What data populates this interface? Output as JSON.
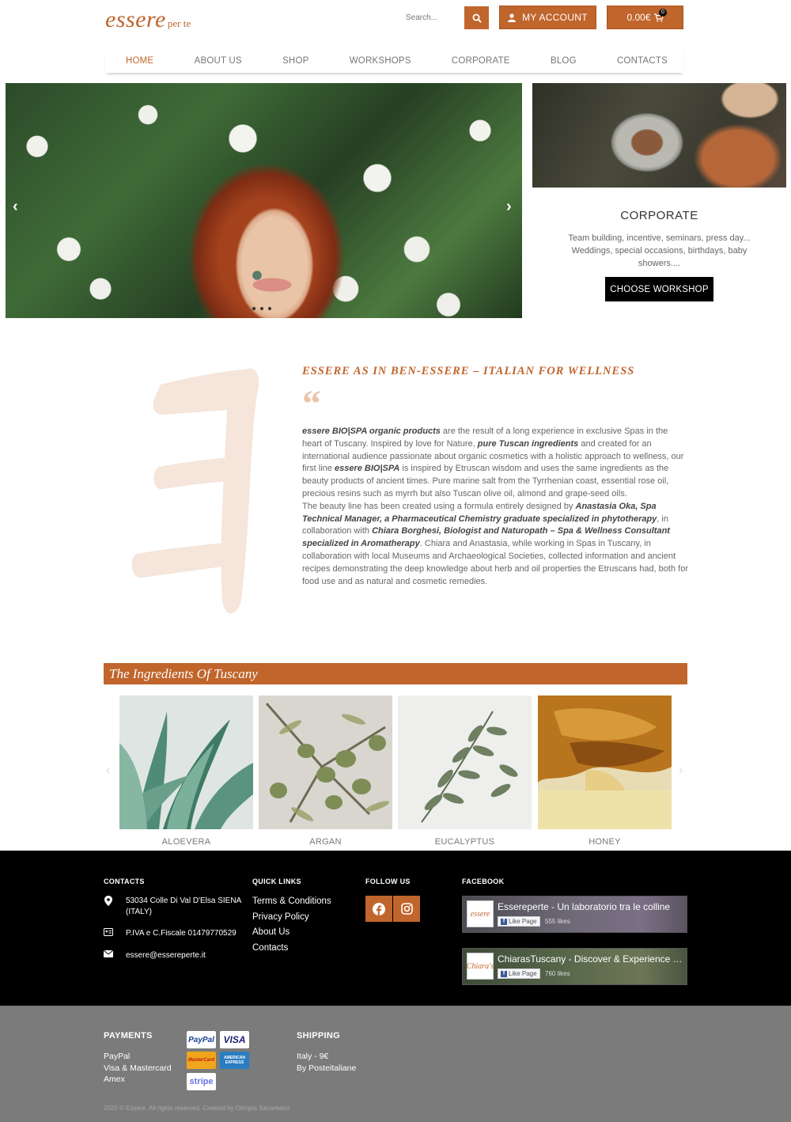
{
  "header": {
    "logo_main": "essere",
    "logo_sub": "per te",
    "search_placeholder": "Search...",
    "account_label": "MY ACCOUNT",
    "cart_total": "0.00€",
    "cart_count": "0"
  },
  "nav": {
    "items": [
      {
        "label": "HOME",
        "active": true
      },
      {
        "label": "ABOUT US"
      },
      {
        "label": "SHOP"
      },
      {
        "label": "WORKSHOPS"
      },
      {
        "label": "CORPORATE"
      },
      {
        "label": "BLOG"
      },
      {
        "label": "CONTACTS"
      }
    ]
  },
  "hero": {
    "prev_icon": "chevron-left-icon",
    "next_icon": "chevron-right-icon",
    "slide_count": 3
  },
  "corporate": {
    "title": "CORPORATE",
    "text": "Team building, incentive, seminars, press day... Weddings, special occasions, birthdays, baby showers....",
    "button_label": "CHOOSE WORKSHOP"
  },
  "about": {
    "title": "ESSERE AS IN BEN-ESSERE – ITALIAN FOR WELLNESS",
    "quote_mark": "“",
    "p1_b1": "essere BIO|SPA organic products",
    "p1_t1": " are the result of a long experience in exclusive Spas in the heart of Tuscany. Inspired by love for Nature, ",
    "p1_b2": "pure Tuscan ingredients",
    "p1_t2": " and created for an international audience passionate about organic cosmetics with a holistic approach to wellness, our first line ",
    "p1_b3": "essere BIO|SPA",
    "p1_t3": " is inspired by Etruscan wisdom and uses the same ingredients as the beauty products of ancient times. Pure marine salt from the Tyrrhenian coast, essential rose oil, precious resins such as myrrh but also Tuscan olive oil, almond and grape-seed oils.",
    "p2_t1": "The beauty line has been created using a formula entirely designed by ",
    "p2_b1": "Anastasia Oka, Spa Technical Manager, a Pharmaceutical Chemistry graduate specialized in phytotherapy",
    "p2_t2": ", in collaboration with ",
    "p2_b2": "Chiara Borghesi, Biologist and Naturopath – Spa & Wellness Consultant specialized in Aromatherapy",
    "p2_t3": ". Chiara and Anastasia, while working in Spas in Tuscany, in collaboration with local Museums and Archaeological Societies, collected information and ancient recipes demonstrating the deep knowledge about herb and oil properties the Etruscans had, both for food use and as natural and cosmetic remedies."
  },
  "ingredients": {
    "title": "The Ingredients Of Tuscany",
    "items": [
      {
        "label": "ALOEVERA"
      },
      {
        "label": "ARGAN"
      },
      {
        "label": "EUCALYPTUS"
      },
      {
        "label": "HONEY"
      }
    ]
  },
  "footer": {
    "contacts_heading": "CONTACTS",
    "address": "53034 Colle Di Val D'Elsa SIENA (ITALY)",
    "vat": "P.IVA e C.Fiscale 01479770529",
    "email": "essere@essereperte.it",
    "quick_links_heading": "QUICK LINKS",
    "quick_links": [
      "Terms & Conditions",
      "Privacy Policy",
      "About Us",
      "Contacts"
    ],
    "follow_heading": "FOLLOW US",
    "facebook_heading": "FACEBOOK",
    "fb_pages": [
      {
        "name": "Essereperte - Un laboratorio tra le colline",
        "likes": "555 likes",
        "logo": "essere"
      },
      {
        "name": "ChiarasTuscany - Discover & Experience Tuscany",
        "likes": "760 likes",
        "logo": "Chiara's"
      }
    ],
    "like_label": "Like Page"
  },
  "bottom": {
    "payments_heading": "PAYMENTS",
    "payments": [
      "PayPal",
      "Visa & Mastercard",
      "Amex"
    ],
    "shipping_heading": "SHIPPING",
    "shipping": [
      "Italy - 9€",
      "By Posteitaliane"
    ],
    "card_paypal": "PayPal",
    "card_visa": "VISA",
    "card_mc": "MasterCard",
    "card_amex": "AMERICAN EXPRESS",
    "card_stripe": "stripe",
    "copyright": "2020 © Essere. All rights reserved. Created by Olimpia Sacareanu"
  },
  "colors": {
    "accent": "#c0652c",
    "footer_dark": "#000000",
    "footer_grey": "#7b7b7b"
  }
}
